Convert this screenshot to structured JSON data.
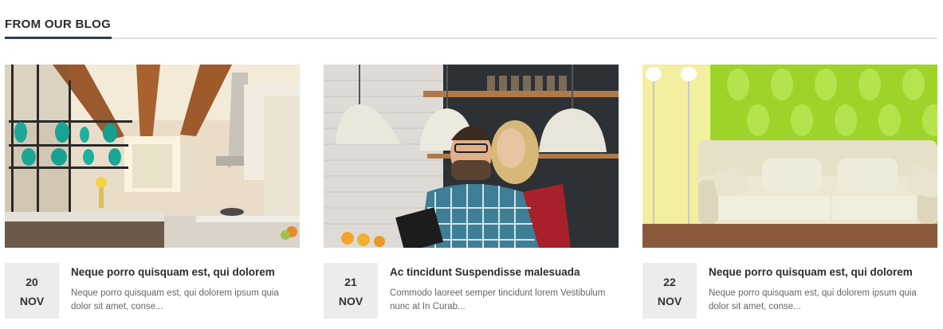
{
  "section": {
    "title": "FROM OUR BLOG"
  },
  "colors": {
    "accent": "#2c3e50",
    "rule": "#e1e1e1",
    "date_bg": "#ececec"
  },
  "posts": [
    {
      "day": "20",
      "month": "NOV",
      "title": "Neque porro quisquam est, qui dolorem",
      "excerpt": "Neque porro quisquam est, qui dolorem ipsum quia dolor sit amet, conse...",
      "image": "kitchen-interior-photo"
    },
    {
      "day": "21",
      "month": "NOV",
      "title": "Ac tincidunt Suspendisse malesuada",
      "excerpt": "Commodo laoreet semper tincidunt lorem Vestibulum nunc at In Curab...",
      "image": "couple-with-tablet-photo"
    },
    {
      "day": "22",
      "month": "NOV",
      "title": "Neque porro quisquam est, qui dolorem",
      "excerpt": "Neque porro quisquam est, qui dolorem ipsum quia dolor sit amet, conse...",
      "image": "sofa-green-wallpaper-photo"
    }
  ]
}
